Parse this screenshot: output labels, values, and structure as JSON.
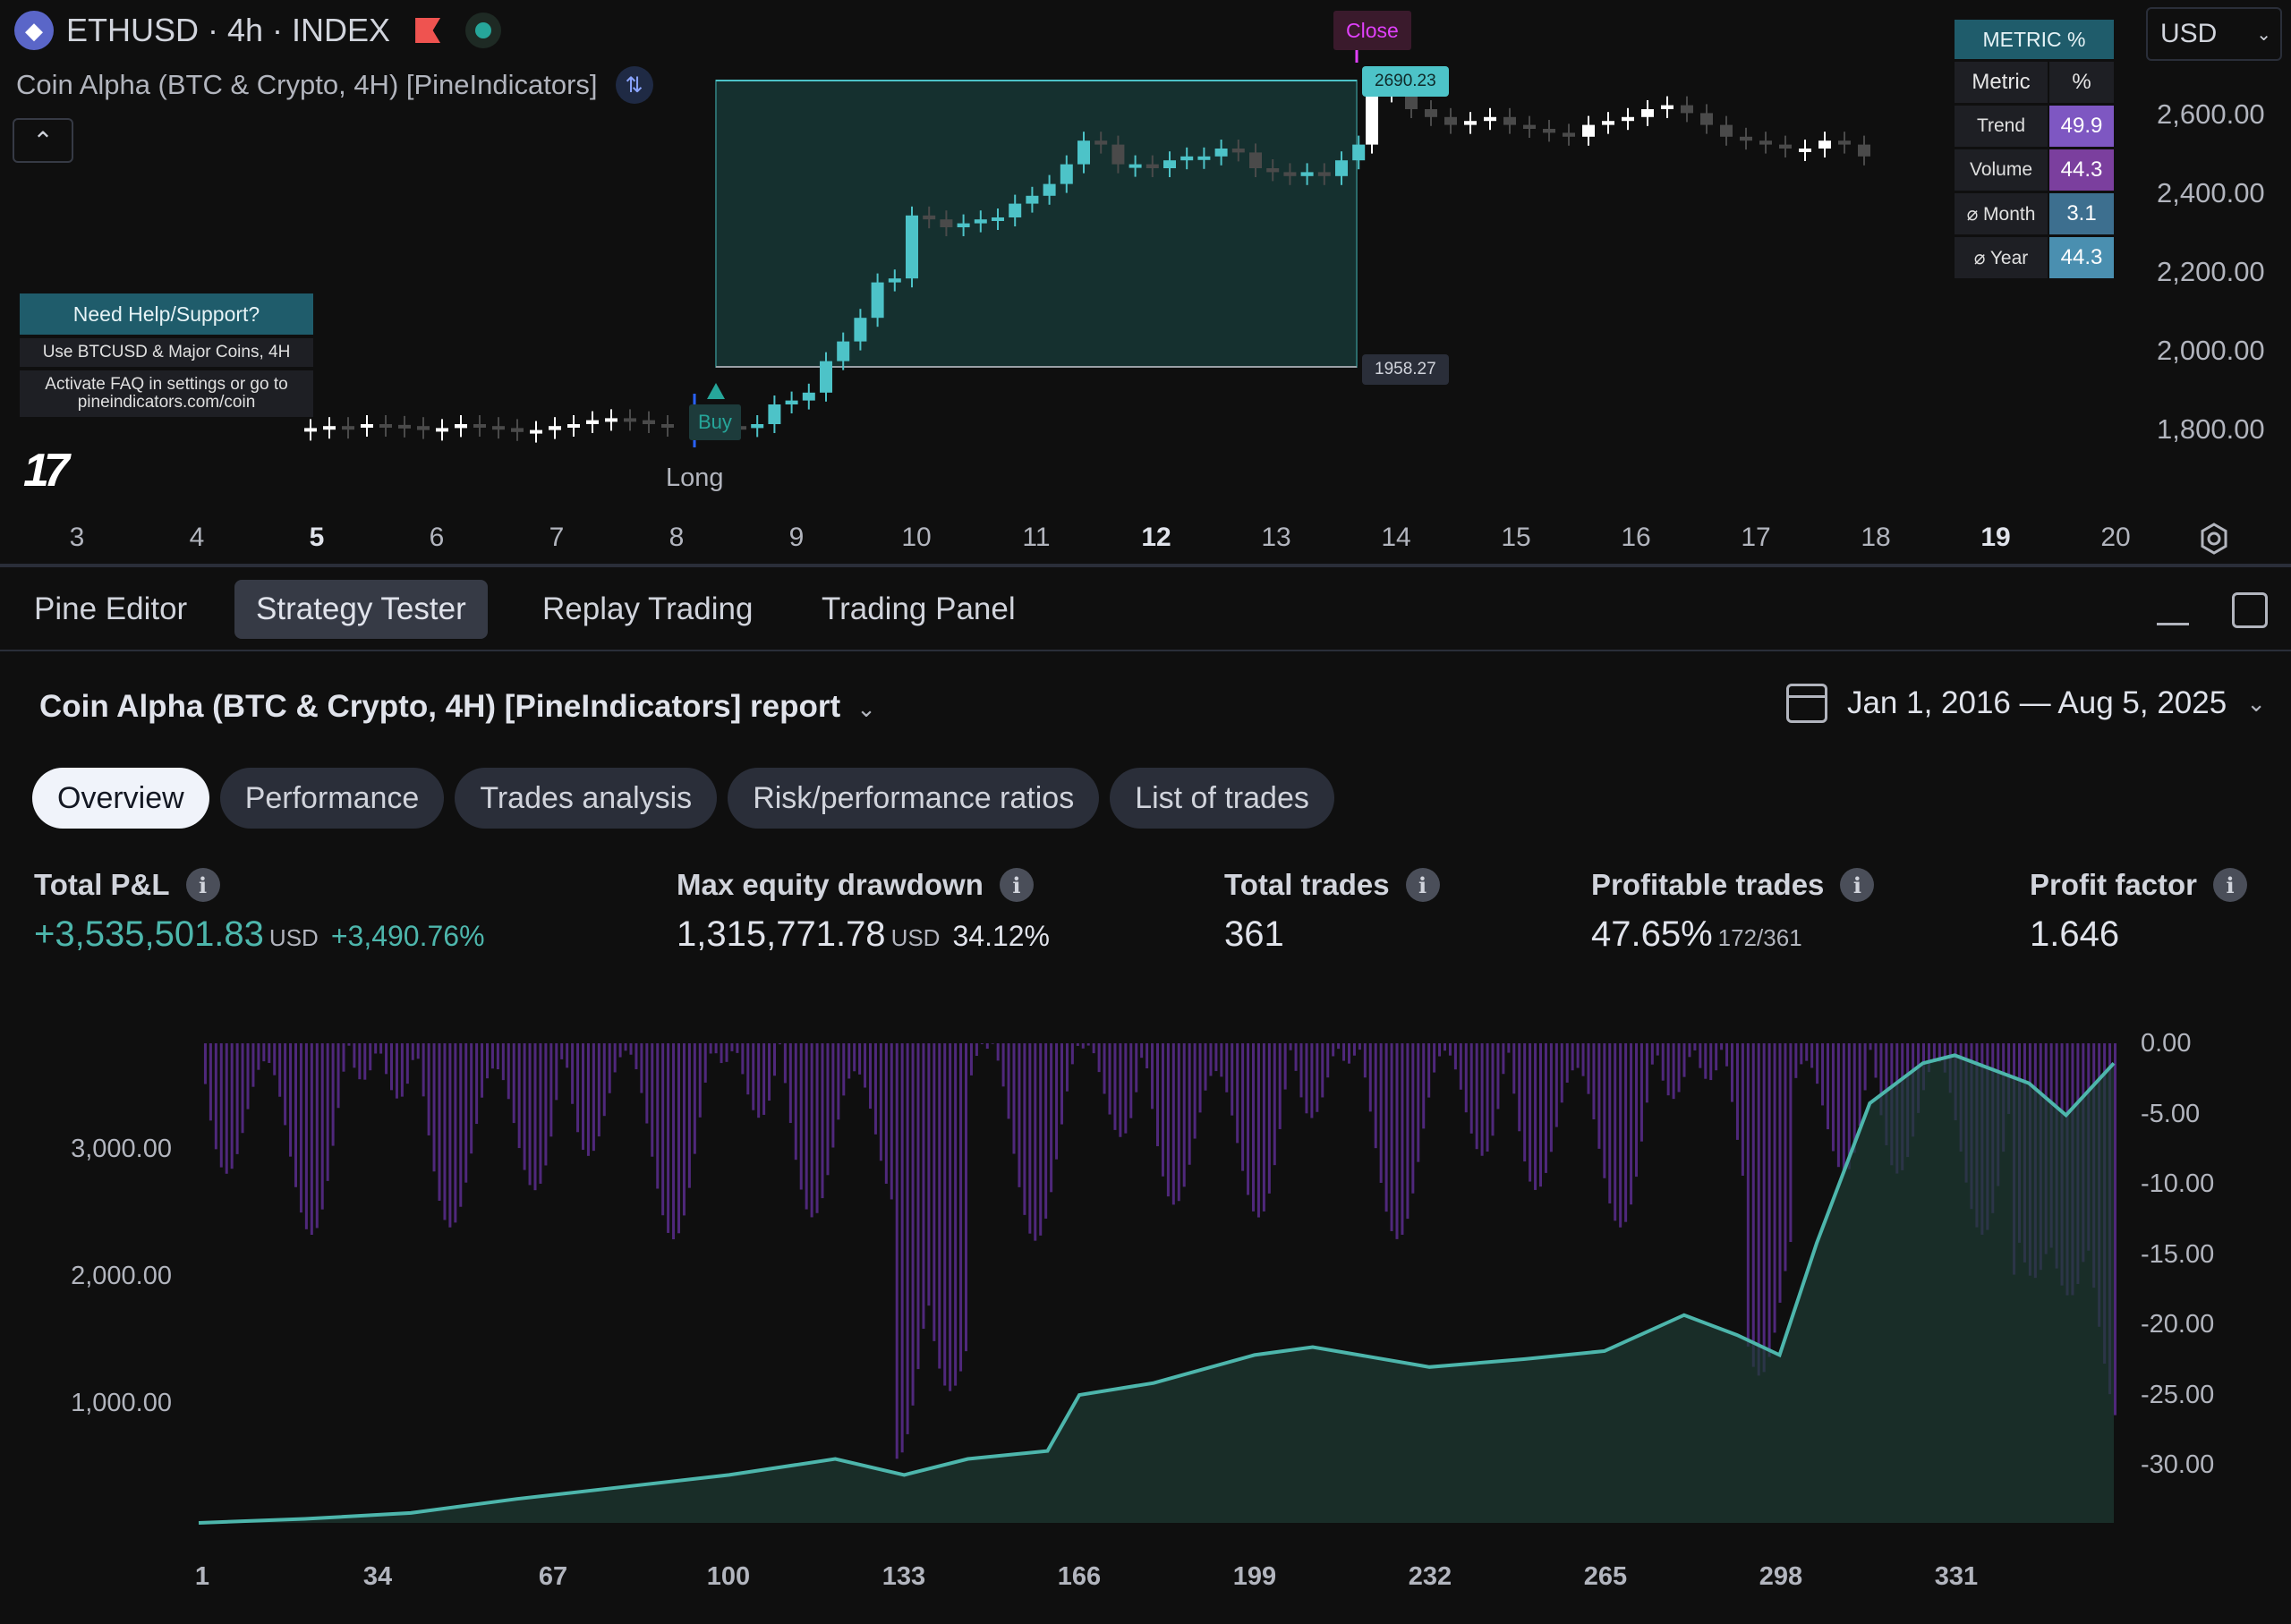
{
  "header": {
    "symbol": "ETHUSD · 4h · INDEX",
    "indicator": "Coin Alpha (BTC & Crypto, 4H) [PineIndicators]",
    "currency": "USD"
  },
  "help_box": {
    "title": "Need Help/Support?",
    "line1": "Use BTCUSD & Major Coins, 4H",
    "line2": "Activate FAQ in settings or go to pineindicators.com/coin"
  },
  "trade": {
    "buy_label": "Buy",
    "long_label": "Long",
    "close_label": "Close",
    "entry_price": "1958.27",
    "exit_price": "2690.23"
  },
  "metric_table": {
    "title": "METRIC %",
    "col_metric": "Metric",
    "col_pct": "%",
    "rows": [
      {
        "label": "Trend",
        "value": "49.9",
        "color": "#7e57c2"
      },
      {
        "label": "Volume",
        "value": "44.3",
        "color": "#7b3f9e"
      },
      {
        "label": "⌀ Month",
        "value": "3.1",
        "color": "#3d6f8f"
      },
      {
        "label": "⌀ Year",
        "value": "44.3",
        "color": "#4a8fb0"
      }
    ]
  },
  "price_axis": [
    "2,600.00",
    "2,400.00",
    "2,200.00",
    "2,000.00",
    "1,800.00"
  ],
  "date_axis": [
    {
      "label": "3",
      "bold": false
    },
    {
      "label": "4",
      "bold": false
    },
    {
      "label": "5",
      "bold": true
    },
    {
      "label": "6",
      "bold": false
    },
    {
      "label": "7",
      "bold": false
    },
    {
      "label": "8",
      "bold": false
    },
    {
      "label": "9",
      "bold": false
    },
    {
      "label": "10",
      "bold": false
    },
    {
      "label": "11",
      "bold": false
    },
    {
      "label": "12",
      "bold": true
    },
    {
      "label": "13",
      "bold": false
    },
    {
      "label": "14",
      "bold": false
    },
    {
      "label": "15",
      "bold": false
    },
    {
      "label": "16",
      "bold": false
    },
    {
      "label": "17",
      "bold": false
    },
    {
      "label": "18",
      "bold": false
    },
    {
      "label": "19",
      "bold": true
    },
    {
      "label": "20",
      "bold": false
    }
  ],
  "panel_tabs": [
    "Pine Editor",
    "Strategy Tester",
    "Replay Trading",
    "Trading Panel"
  ],
  "report": {
    "title": "Coin Alpha (BTC & Crypto, 4H) [PineIndicators] report",
    "date_range": "Jan 1, 2016 — Aug 5, 2025"
  },
  "sub_tabs": [
    "Overview",
    "Performance",
    "Trades analysis",
    "Risk/performance ratios",
    "List of trades"
  ],
  "stats": {
    "pnl_label": "Total P&L",
    "pnl_value": "+3,535,501.83",
    "pnl_unit": "USD",
    "pnl_pct": "+3,490.76%",
    "dd_label": "Max equity drawdown",
    "dd_value": "1,315,771.78",
    "dd_unit": "USD",
    "dd_pct": "34.12%",
    "trades_label": "Total trades",
    "trades_value": "361",
    "profitable_label": "Profitable trades",
    "profitable_value": "47.65%",
    "profitable_ratio": "172/361",
    "pf_label": "Profit factor",
    "pf_value": "1.646"
  },
  "equity_axis_left": [
    "3,000.00",
    "2,000.00",
    "1,000.00"
  ],
  "equity_axis_right": [
    "0.00",
    "-5.00",
    "-10.00",
    "-15.00",
    "-20.00",
    "-25.00",
    "-30.00"
  ],
  "equity_axis_x": [
    "1",
    "34",
    "67",
    "100",
    "133",
    "166",
    "199",
    "232",
    "265",
    "298",
    "331"
  ],
  "colors": {
    "up": "#4dc3c8",
    "down": "#4a4a4a",
    "equity_line": "#4db6ac",
    "drawdown": "#5b2d8e",
    "trade_box": "#15302f"
  }
}
